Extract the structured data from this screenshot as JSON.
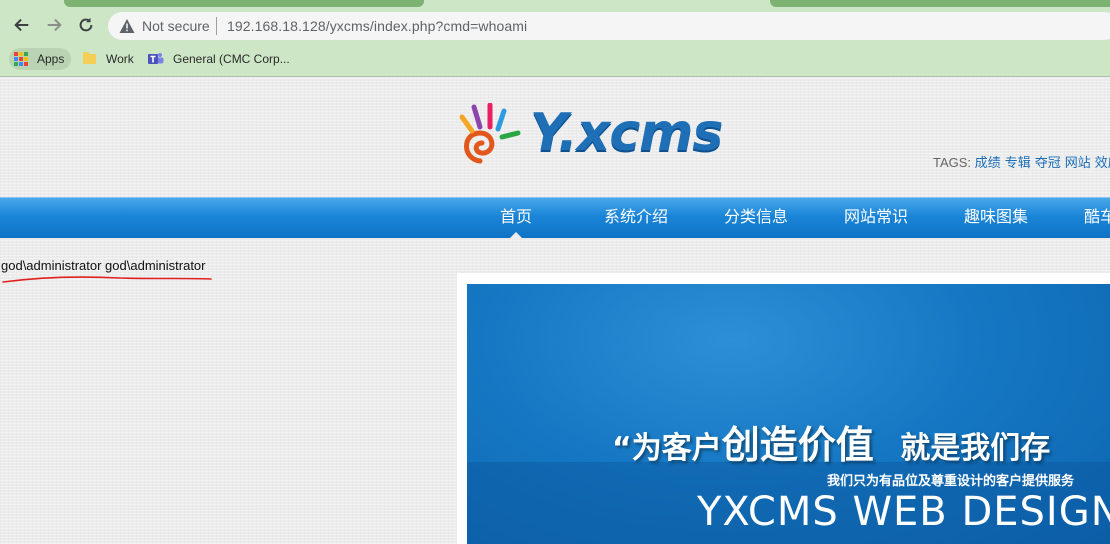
{
  "browser": {
    "security_label": "Not secure",
    "url": "192.168.18.128/yxcms/index.php?cmd=whoami",
    "bookmarks": [
      {
        "label": "Apps",
        "icon": "apps-grid-icon"
      },
      {
        "label": "Work",
        "icon": "folder-icon"
      },
      {
        "label": "General (CMC Corp...",
        "icon": "teams-icon"
      }
    ]
  },
  "site": {
    "logo_text": "Y.xcms",
    "tags_label": "TAGS:",
    "tags": [
      "成绩",
      "专辑",
      "夺冠",
      "网站",
      "效应"
    ],
    "nav": [
      "首页",
      "系统介绍",
      "分类信息",
      "网站常识",
      "趣味图集",
      "酷车"
    ],
    "command_output": "god\\administrator god\\administrator",
    "banner": {
      "slogan_part1": "“为客户",
      "slogan_part2": "创造价值",
      "slogan_part3": "就是我们存",
      "subtitle": "我们只为有品位及尊重设计的客户提供服务",
      "headline": "YXCMS WEB DESIGN ST"
    }
  },
  "colors": {
    "chrome_bg": "#cde6c6",
    "nav_blue": "#1a85d8",
    "link_blue": "#1a6eb8",
    "annotation_red": "#e02020"
  }
}
